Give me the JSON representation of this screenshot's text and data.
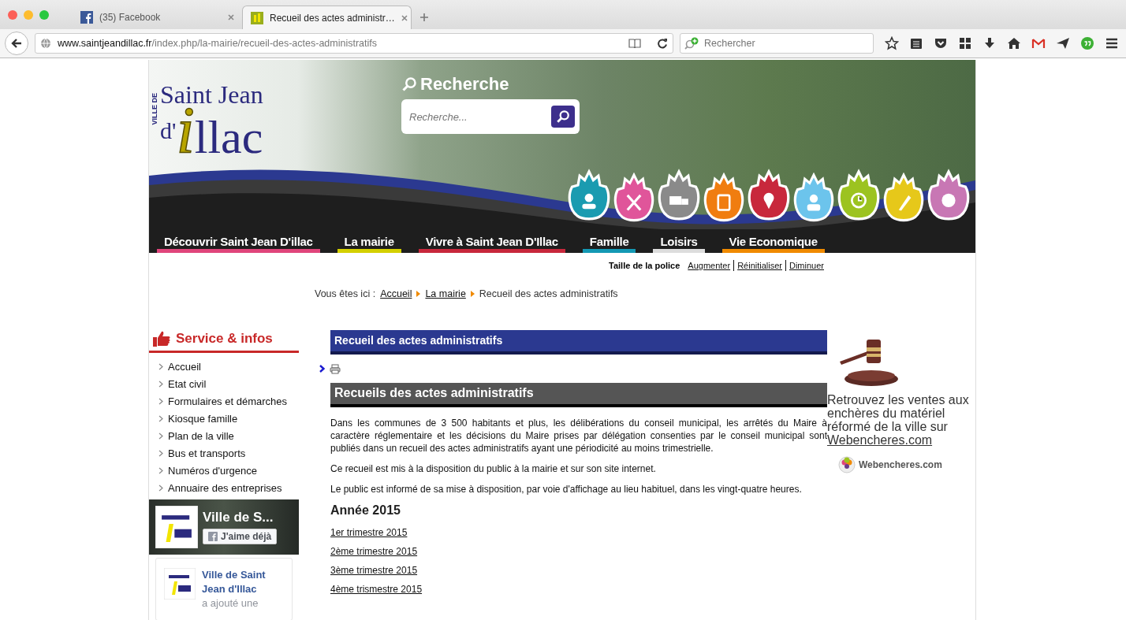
{
  "browser": {
    "tabs": [
      {
        "title": "(35) Facebook",
        "selected": false
      },
      {
        "title": "Recueil des actes administr…",
        "selected": true
      }
    ],
    "url": {
      "domain": "www.saintjeandillac.fr",
      "path": "/index.php/la-mairie/recueil-des-actes-administratifs"
    },
    "search": {
      "placeholder": "Rechercher"
    }
  },
  "header": {
    "logo": {
      "caption": "VILLE DE",
      "line1": "Saint Jean",
      "prefix": "d'",
      "initial": "i",
      "rest": "llac"
    },
    "search": {
      "title": "Recherche",
      "placeholder": "Recherche..."
    },
    "categories": [
      {
        "color": "#1a9bb0"
      },
      {
        "color": "#e0559a"
      },
      {
        "color": "#8a8a8a"
      },
      {
        "color": "#f07d10"
      },
      {
        "color": "#c8283c"
      },
      {
        "color": "#6cc4ec"
      },
      {
        "color": "#9cc320"
      },
      {
        "color": "#e6c81a"
      },
      {
        "color": "#c877b4"
      }
    ],
    "nav": [
      {
        "label": "Découvrir Saint Jean D'illac",
        "color": "#e0457b"
      },
      {
        "label": "La mairie",
        "color": "#d4d000"
      },
      {
        "label": "Vivre à Saint Jean D'Illac",
        "color": "#c8283c"
      },
      {
        "label": "Famille",
        "color": "#1499b4"
      },
      {
        "label": "Loisirs",
        "color": "#dddddd"
      },
      {
        "label": "Vie Economique",
        "color": "#f08a00"
      }
    ]
  },
  "font_size": {
    "label": "Taille de la police",
    "links": [
      "Augmenter",
      "Réinitialiser",
      "Diminuer"
    ]
  },
  "breadcrumb": {
    "prefix": "Vous êtes ici :",
    "links": [
      "Accueil",
      "La mairie"
    ],
    "current": "Recueil des actes administratifs"
  },
  "sidebar": {
    "title": "Service & infos",
    "items": [
      "Accueil",
      "Etat civil",
      "Formulaires et démarches",
      "Kiosque famille",
      "Plan de la ville",
      "Bus et transports",
      "Numéros d'urgence",
      "Annuaire des entreprises"
    ],
    "facebook": {
      "page_name": "Ville de S...",
      "like_button": "J'aime déjà",
      "post_author": "Ville de Saint Jean d'Illac",
      "post_text": "a ajouté une"
    }
  },
  "main": {
    "page_title": "Recueil des actes administratifs",
    "article_title": "Recueils des actes administratifs",
    "paragraphs": [
      "Dans les communes de 3 500 habitants et plus, les délibérations du conseil municipal, les arrêtés du Maire à caractère réglementaire et les décisions du Maire prises par délégation consenties par le conseil municipal sont publiés dans un recueil des actes administratifs ayant une périodicité au moins trimestrielle.",
      "Ce recueil est mis à la disposition du public à la mairie et sur son site internet.",
      "Le public est informé de sa mise à disposition, par voie d'affichage au lieu habituel, dans les vingt-quatre heures."
    ],
    "year": "Année 2015",
    "links": [
      "1er trimestre 2015",
      "2ème trimestre 2015",
      "3ème trimestre 2015",
      "4ème trismestre 2015"
    ]
  },
  "aside": {
    "text": "Retrouvez les ventes aux enchères du matériel réformé de la ville sur",
    "link": "Webencheres.com",
    "logo_text": "Webencheres.com"
  }
}
